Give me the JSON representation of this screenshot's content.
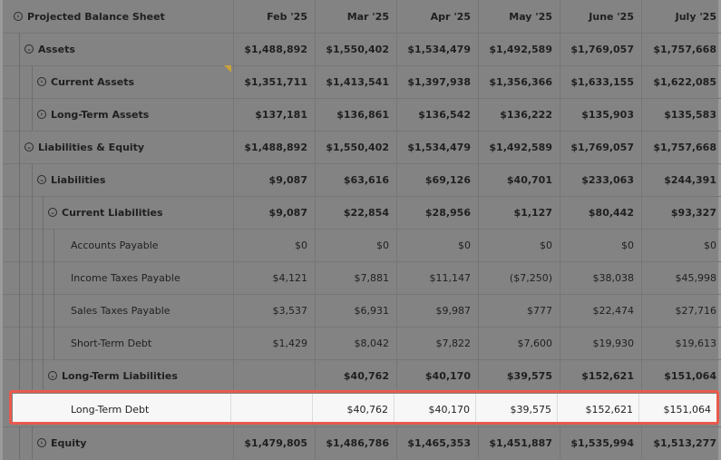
{
  "header": {
    "title": "Projected Balance Sheet",
    "months": [
      "Feb '25",
      "Mar '25",
      "Apr '25",
      "May '25",
      "June '25",
      "July '25"
    ]
  },
  "rows": [
    {
      "label": "Assets",
      "values": [
        "$1,488,892",
        "$1,550,402",
        "$1,534,479",
        "$1,492,589",
        "$1,769,057",
        "$1,757,668"
      ]
    },
    {
      "label": "Current Assets",
      "values": [
        "$1,351,711",
        "$1,413,541",
        "$1,397,938",
        "$1,356,366",
        "$1,633,155",
        "$1,622,085"
      ]
    },
    {
      "label": "Long-Term Assets",
      "values": [
        "$137,181",
        "$136,861",
        "$136,542",
        "$136,222",
        "$135,903",
        "$135,583"
      ]
    },
    {
      "label": "Liabilities & Equity",
      "values": [
        "$1,488,892",
        "$1,550,402",
        "$1,534,479",
        "$1,492,589",
        "$1,769,057",
        "$1,757,668"
      ]
    },
    {
      "label": "Liabilities",
      "values": [
        "$9,087",
        "$63,616",
        "$69,126",
        "$40,701",
        "$233,063",
        "$244,391"
      ]
    },
    {
      "label": "Current Liabilities",
      "values": [
        "$9,087",
        "$22,854",
        "$28,956",
        "$1,127",
        "$80,442",
        "$93,327"
      ]
    },
    {
      "label": "Accounts Payable",
      "values": [
        "$0",
        "$0",
        "$0",
        "$0",
        "$0",
        "$0"
      ]
    },
    {
      "label": "Income Taxes Payable",
      "values": [
        "$4,121",
        "$7,881",
        "$11,147",
        "($7,250)",
        "$38,038",
        "$45,998"
      ]
    },
    {
      "label": "Sales Taxes Payable",
      "values": [
        "$3,537",
        "$6,931",
        "$9,987",
        "$777",
        "$22,474",
        "$27,716"
      ]
    },
    {
      "label": "Short-Term Debt",
      "values": [
        "$1,429",
        "$8,042",
        "$7,822",
        "$7,600",
        "$19,930",
        "$19,613"
      ]
    },
    {
      "label": "Long-Term Liabilities",
      "values": [
        "",
        "$40,762",
        "$40,170",
        "$39,575",
        "$152,621",
        "$151,064"
      ]
    },
    {
      "label": "Long-Term Debt",
      "values": [
        "",
        "$40,762",
        "$40,170",
        "$39,575",
        "$152,621",
        "$151,064"
      ]
    },
    {
      "label": "Equity",
      "values": [
        "$1,479,805",
        "$1,486,786",
        "$1,465,353",
        "$1,451,887",
        "$1,535,994",
        "$1,513,277"
      ]
    }
  ],
  "icons": {
    "expand": "chevron-right-circle-icon",
    "collapse": "chevron-down-circle-icon"
  },
  "colors": {
    "highlight_border": "#e8594d",
    "flag": "#c9a03a"
  }
}
